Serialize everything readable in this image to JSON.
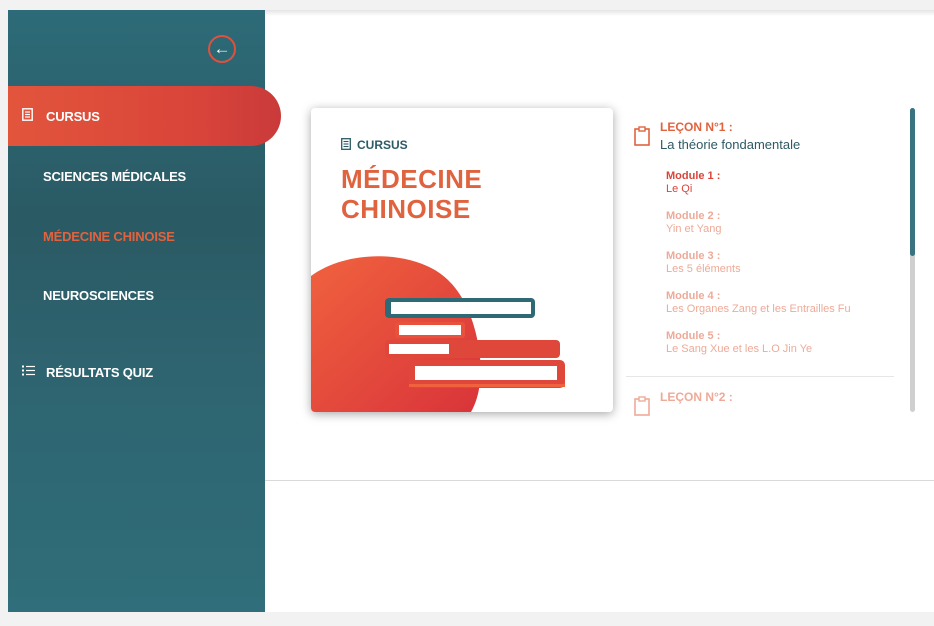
{
  "colors": {
    "accent": "#e0633f",
    "sidebar": "#2d6b78",
    "teal_text": "#2d5a65",
    "dim_module": "#eeaa98"
  },
  "sidebar": {
    "back_icon": "arrow-left-icon",
    "items": [
      {
        "label": "CURSUS",
        "icon": "book-icon"
      },
      {
        "label": "SCIENCES MÉDICALES"
      },
      {
        "label": "MÉDECINE CHINOISE"
      },
      {
        "label": "NEUROSCIENCES"
      },
      {
        "label": "RÉSULTATS QUIZ",
        "icon": "list-icon"
      }
    ]
  },
  "card": {
    "tag": "CURSUS",
    "title_line1": "MÉDECINE",
    "title_line2": "CHINOISE"
  },
  "lessons": [
    {
      "number": "LEÇON N°1 :",
      "title": "La théorie fondamentale",
      "modules": [
        {
          "title": "Module 1 :",
          "name": "Le Qi"
        },
        {
          "title": "Module 2 :",
          "name": "Yin et Yang"
        },
        {
          "title": "Module 3 :",
          "name": "Les 5 éléments"
        },
        {
          "title": "Module 4 :",
          "name": "Les Organes Zang et les Entrailles Fu"
        },
        {
          "title": "Module 5 :",
          "name": "Le Sang Xue et les L.O Jin Ye"
        }
      ]
    },
    {
      "number": "LEÇON N°2 :",
      "title": ""
    }
  ]
}
